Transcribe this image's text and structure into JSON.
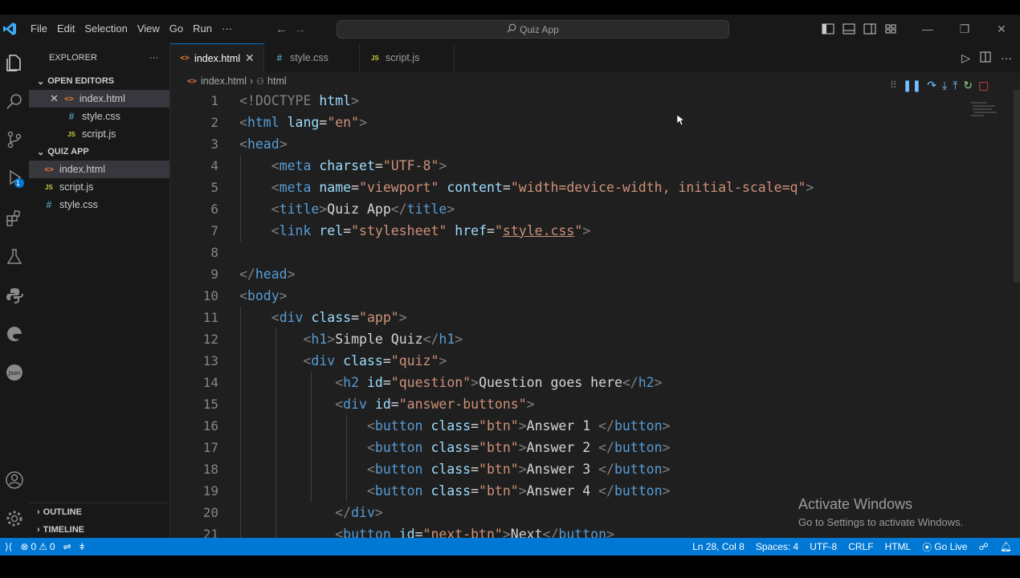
{
  "menu": [
    "File",
    "Edit",
    "Selection",
    "View",
    "Go",
    "Run",
    "···"
  ],
  "search": {
    "text": "Quiz App"
  },
  "explorer": {
    "title": "EXPLORER",
    "more": "···",
    "open_editors_label": "OPEN EDITORS",
    "open_editors": [
      {
        "name": "index.html",
        "type": "html"
      },
      {
        "name": "style.css",
        "type": "css"
      },
      {
        "name": "script.js",
        "type": "js"
      }
    ],
    "folder_label": "QUIZ APP",
    "files": [
      {
        "name": "index.html",
        "type": "html"
      },
      {
        "name": "script.js",
        "type": "js"
      },
      {
        "name": "style.css",
        "type": "css"
      }
    ],
    "outline_label": "OUTLINE",
    "timeline_label": "TIMELINE"
  },
  "tabs": [
    {
      "name": "index.html",
      "type": "html"
    },
    {
      "name": "style.css",
      "type": "css"
    },
    {
      "name": "script.js",
      "type": "js"
    }
  ],
  "breadcrumb": {
    "file": "index.html",
    "symbol": "html"
  },
  "line_numbers": [
    "1",
    "2",
    "3",
    "4",
    "5",
    "6",
    "7",
    "8",
    "9",
    "10",
    "11",
    "12",
    "13",
    "14",
    "15",
    "16",
    "17",
    "18",
    "19",
    "20",
    "21"
  ],
  "code": {
    "doctype_open": "<!DOCTYPE ",
    "doctype_name": "html",
    "doctype_close": ">",
    "html_lang": "\"en\"",
    "charset": "\"UTF-8\"",
    "viewport_name": "\"viewport\"",
    "viewport_content": "\"width=device-width, initial-scale=q\"",
    "title_text": "Quiz App",
    "link_rel": "\"stylesheet\"",
    "link_href": "style.css",
    "app_class": "\"app\"",
    "h1_text": "Simple Quiz",
    "quiz_class": "\"quiz\"",
    "question_id": "\"question\"",
    "question_text": "Question goes here",
    "answers_id": "\"answer-buttons\"",
    "btn_class": "\"btn\"",
    "answers": [
      "Answer 1 ",
      "Answer 2 ",
      "Answer 3 ",
      "Answer 4 "
    ],
    "next_id": "\"next-btn\"",
    "next_text": "Next"
  },
  "watermark": {
    "title": "Activate Windows",
    "subtitle": "Go to Settings to activate Windows."
  },
  "status": {
    "errors": "0",
    "warnings": "0",
    "position": "Ln 28, Col 8",
    "spaces": "Spaces: 4",
    "encoding": "UTF-8",
    "eol": "CRLF",
    "language": "HTML",
    "golive": "Go Live"
  },
  "activity_badge": "1",
  "colors": {
    "accent": "#0078d4",
    "statusbar": "#0078d4",
    "debug_stop": "#f14c4c",
    "debug_restart": "#89d185"
  }
}
